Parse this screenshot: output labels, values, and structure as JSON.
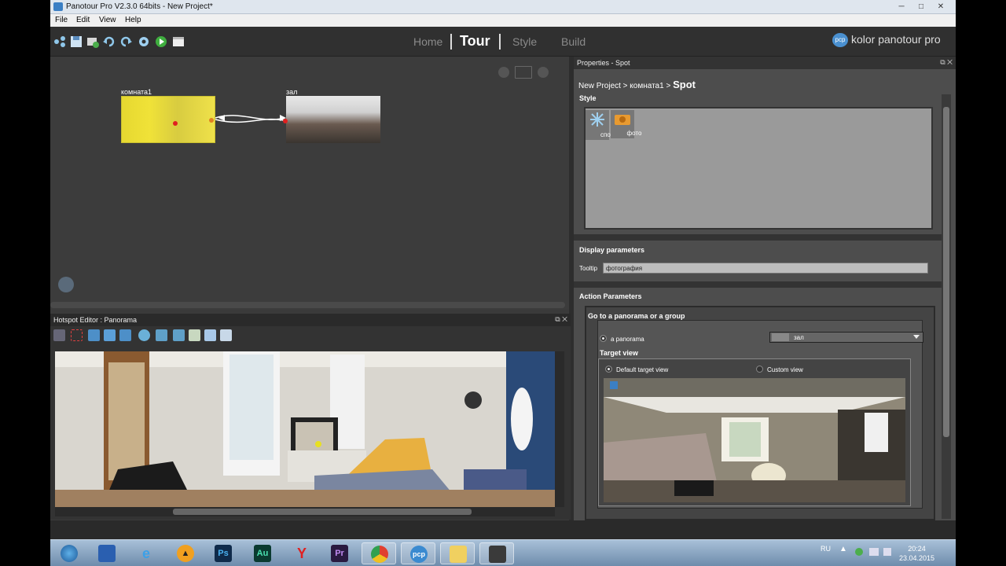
{
  "window": {
    "title": "Panotour Pro V2.3.0 64bits - New Project*",
    "controls": {
      "minimize": "─",
      "maximize": "□",
      "close": "✕"
    }
  },
  "menu": [
    "File",
    "Edit",
    "View",
    "Help"
  ],
  "toolbar": {
    "icons": [
      "share-icon",
      "save-icon",
      "add-panorama-icon",
      "undo-icon",
      "redo-icon",
      "settings-icon",
      "play-icon",
      "export-icon"
    ]
  },
  "modes": {
    "home": "Home",
    "tour": "Tour",
    "style": "Style",
    "build": "Build",
    "active": "Tour"
  },
  "brand": {
    "logo": "pcp",
    "name": "kolor panotour pro"
  },
  "tour_canvas": {
    "nodes": [
      {
        "label": "комната1",
        "selected": true
      },
      {
        "label": "зал",
        "selected": false
      }
    ]
  },
  "hotspot_editor": {
    "title": "Hotspot Editor : Panorama",
    "buttons": {
      "float": "⧉",
      "close": "✕"
    }
  },
  "properties": {
    "title": "Properties - Spot",
    "breadcrumb": {
      "path": "New Project > комната1 > ",
      "current": "Spot"
    },
    "style": {
      "heading": "Style",
      "items": [
        {
          "label": "споты",
          "icon": "sparkle-icon"
        },
        {
          "label": "фото",
          "icon": "photo-icon"
        }
      ]
    },
    "display": {
      "heading": "Display parameters",
      "tooltip_label": "Tooltip",
      "tooltip_value": "фотография"
    },
    "action": {
      "heading": "Action Parameters",
      "subheading": "Go to a panorama or a group",
      "panorama_radio": "a panorama",
      "panorama_value": "зал",
      "target_view_heading": "Target view",
      "default_view": "Default target view",
      "custom_view": "Custom view"
    }
  },
  "taskbar": {
    "apps": [
      {
        "name": "windows-start",
        "label": ""
      },
      {
        "name": "save-app",
        "label": ""
      },
      {
        "name": "ie-browser",
        "label": "e"
      },
      {
        "name": "aimp-player",
        "label": "▲"
      },
      {
        "name": "photoshop",
        "label": "Ps"
      },
      {
        "name": "audition",
        "label": "Au"
      },
      {
        "name": "yandex-browser",
        "label": "Y"
      },
      {
        "name": "premiere",
        "label": "Pr"
      },
      {
        "name": "chrome",
        "label": ""
      },
      {
        "name": "panotour-pro",
        "label": "pcp"
      },
      {
        "name": "file-explorer",
        "label": ""
      },
      {
        "name": "video-converter",
        "label": ""
      }
    ],
    "lang": "RU",
    "time": "20:24",
    "date": "23.04.2015"
  },
  "colors": {
    "selected_node": "#f0e030",
    "accent_orange": "#e8a030",
    "accent_blue": "#3b7fc4",
    "panel_dark": "#333333"
  }
}
